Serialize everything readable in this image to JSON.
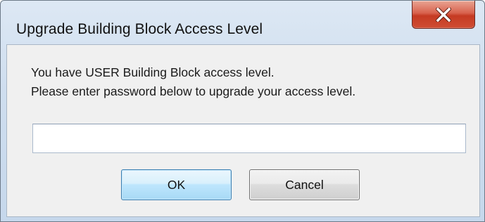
{
  "window": {
    "title": "Upgrade Building Block Access Level"
  },
  "titlebar": {
    "close_icon": "close-x-icon"
  },
  "message": {
    "line1": "You have USER Building Block access level.",
    "line2": "Please enter password below to upgrade your access level."
  },
  "password": {
    "value": "",
    "placeholder": ""
  },
  "buttons": {
    "ok_label": "OK",
    "cancel_label": "Cancel"
  },
  "colors": {
    "titlebar": "#cfdeef",
    "close_button": "#c53a22",
    "client_background": "#f0f0f0",
    "ok_border": "#3c7fb1"
  }
}
